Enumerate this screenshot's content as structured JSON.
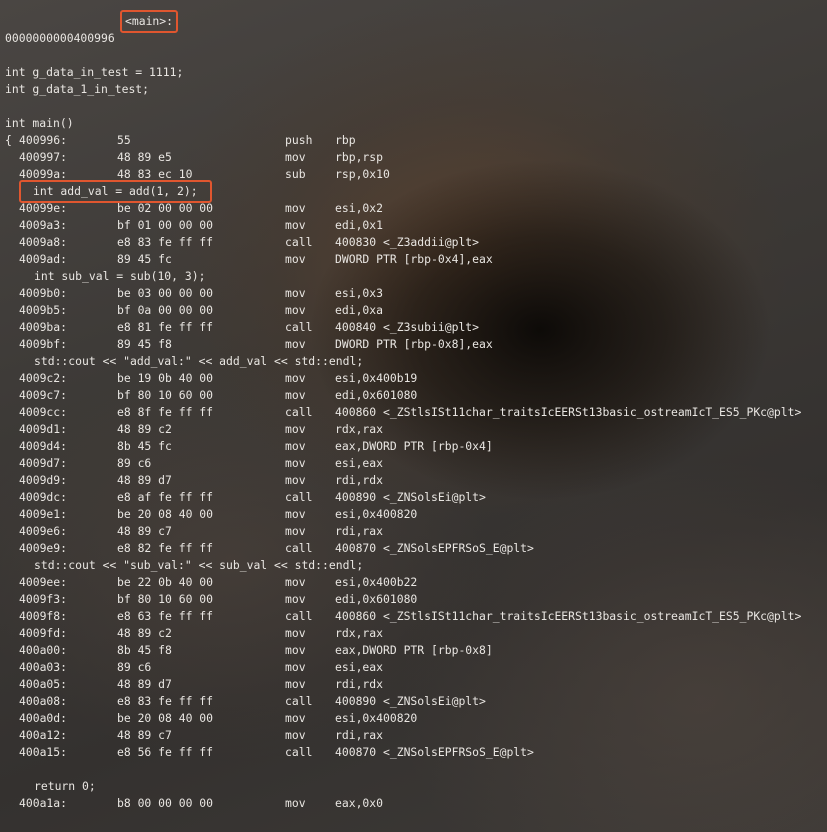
{
  "header": {
    "address": "0000000000400996",
    "symbol": "<main>:"
  },
  "decls": [
    "int g_data_in_test = 1111;",
    "int g_data_1_in_test;"
  ],
  "func_sig": "int main()",
  "open_brace": "{",
  "close_brace": "}",
  "blocks": [
    {
      "asm": [
        {
          "addr": "400996:",
          "hex": "55",
          "mn": "push",
          "op": "rbp"
        },
        {
          "addr": "400997:",
          "hex": "48 89 e5",
          "mn": "mov",
          "op": "rbp,rsp"
        },
        {
          "addr": "40099a:",
          "hex": "48 83 ec 10",
          "mn": "sub",
          "op": "rsp,0x10"
        }
      ]
    },
    {
      "src": "int add_val = add(1, 2);",
      "highlight": true,
      "asm": [
        {
          "addr": "40099e:",
          "hex": "be 02 00 00 00",
          "mn": "mov",
          "op": "esi,0x2"
        },
        {
          "addr": "4009a3:",
          "hex": "bf 01 00 00 00",
          "mn": "mov",
          "op": "edi,0x1"
        },
        {
          "addr": "4009a8:",
          "hex": "e8 83 fe ff ff",
          "mn": "call",
          "op": "400830 <_Z3addii@plt>"
        },
        {
          "addr": "4009ad:",
          "hex": "89 45 fc",
          "mn": "mov",
          "op": "DWORD PTR [rbp-0x4],eax"
        }
      ]
    },
    {
      "src": "int sub_val = sub(10, 3);",
      "asm": [
        {
          "addr": "4009b0:",
          "hex": "be 03 00 00 00",
          "mn": "mov",
          "op": "esi,0x3"
        },
        {
          "addr": "4009b5:",
          "hex": "bf 0a 00 00 00",
          "mn": "mov",
          "op": "edi,0xa"
        },
        {
          "addr": "4009ba:",
          "hex": "e8 81 fe ff ff",
          "mn": "call",
          "op": "400840 <_Z3subii@plt>"
        },
        {
          "addr": "4009bf:",
          "hex": "89 45 f8",
          "mn": "mov",
          "op": "DWORD PTR [rbp-0x8],eax"
        }
      ]
    },
    {
      "src": "std::cout << \"add_val:\" << add_val << std::endl;",
      "asm": [
        {
          "addr": "4009c2:",
          "hex": "be 19 0b 40 00",
          "mn": "mov",
          "op": "esi,0x400b19"
        },
        {
          "addr": "4009c7:",
          "hex": "bf 80 10 60 00",
          "mn": "mov",
          "op": "edi,0x601080"
        },
        {
          "addr": "4009cc:",
          "hex": "e8 8f fe ff ff",
          "mn": "call",
          "op": "400860 <_ZStlsISt11char_traitsIcEERSt13basic_ostreamIcT_ES5_PKc@plt>"
        },
        {
          "addr": "4009d1:",
          "hex": "48 89 c2",
          "mn": "mov",
          "op": "rdx,rax"
        },
        {
          "addr": "4009d4:",
          "hex": "8b 45 fc",
          "mn": "mov",
          "op": "eax,DWORD PTR [rbp-0x4]"
        },
        {
          "addr": "4009d7:",
          "hex": "89 c6",
          "mn": "mov",
          "op": "esi,eax"
        },
        {
          "addr": "4009d9:",
          "hex": "48 89 d7",
          "mn": "mov",
          "op": "rdi,rdx"
        },
        {
          "addr": "4009dc:",
          "hex": "e8 af fe ff ff",
          "mn": "call",
          "op": "400890 <_ZNSolsEi@plt>"
        },
        {
          "addr": "4009e1:",
          "hex": "be 20 08 40 00",
          "mn": "mov",
          "op": "esi,0x400820"
        },
        {
          "addr": "4009e6:",
          "hex": "48 89 c7",
          "mn": "mov",
          "op": "rdi,rax"
        },
        {
          "addr": "4009e9:",
          "hex": "e8 82 fe ff ff",
          "mn": "call",
          "op": "400870 <_ZNSolsEPFRSoS_E@plt>"
        }
      ]
    },
    {
      "src": "std::cout << \"sub_val:\" << sub_val << std::endl;",
      "asm": [
        {
          "addr": "4009ee:",
          "hex": "be 22 0b 40 00",
          "mn": "mov",
          "op": "esi,0x400b22"
        },
        {
          "addr": "4009f3:",
          "hex": "bf 80 10 60 00",
          "mn": "mov",
          "op": "edi,0x601080"
        },
        {
          "addr": "4009f8:",
          "hex": "e8 63 fe ff ff",
          "mn": "call",
          "op": "400860 <_ZStlsISt11char_traitsIcEERSt13basic_ostreamIcT_ES5_PKc@plt>"
        },
        {
          "addr": "4009fd:",
          "hex": "48 89 c2",
          "mn": "mov",
          "op": "rdx,rax"
        },
        {
          "addr": "400a00:",
          "hex": "8b 45 f8",
          "mn": "mov",
          "op": "eax,DWORD PTR [rbp-0x8]"
        },
        {
          "addr": "400a03:",
          "hex": "89 c6",
          "mn": "mov",
          "op": "esi,eax"
        },
        {
          "addr": "400a05:",
          "hex": "48 89 d7",
          "mn": "mov",
          "op": "rdi,rdx"
        },
        {
          "addr": "400a08:",
          "hex": "e8 83 fe ff ff",
          "mn": "call",
          "op": "400890 <_ZNSolsEi@plt>"
        },
        {
          "addr": "400a0d:",
          "hex": "be 20 08 40 00",
          "mn": "mov",
          "op": "esi,0x400820"
        },
        {
          "addr": "400a12:",
          "hex": "48 89 c7",
          "mn": "mov",
          "op": "rdi,rax"
        },
        {
          "addr": "400a15:",
          "hex": "e8 56 fe ff ff",
          "mn": "call",
          "op": "400870 <_ZNSolsEPFRSoS_E@plt>"
        }
      ]
    },
    {
      "src": "return 0;",
      "gap_before": true,
      "asm": [
        {
          "addr": "400a1a:",
          "hex": "b8 00 00 00 00",
          "mn": "mov",
          "op": "eax,0x0"
        }
      ]
    }
  ]
}
